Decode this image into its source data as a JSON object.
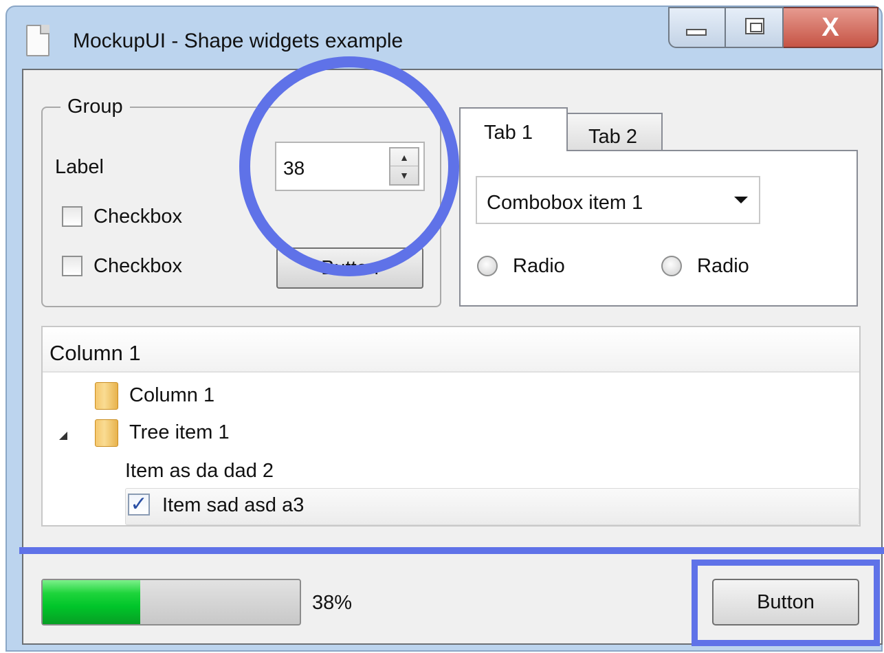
{
  "window": {
    "title": "MockupUI - Shape widgets example",
    "close_glyph": "X",
    "controls": [
      "minimize-icon",
      "maximize-icon",
      "close-icon"
    ]
  },
  "group": {
    "title": "Group",
    "label": "Label",
    "checkboxes": [
      {
        "label": "Checkbox",
        "checked": false
      },
      {
        "label": "Checkbox",
        "checked": false
      }
    ],
    "spinbox_value": "38",
    "button_label": "Button"
  },
  "tabs": {
    "items": [
      {
        "label": "Tab 1",
        "active": true
      },
      {
        "label": "Tab 2",
        "active": false
      }
    ],
    "combobox_value": "Combobox item 1",
    "radios": [
      {
        "label": "Radio",
        "selected": false
      },
      {
        "label": "Radio",
        "selected": false
      }
    ]
  },
  "tree": {
    "header": "Column 1",
    "items": [
      {
        "label": "Column 1",
        "icon": "folder-icon"
      },
      {
        "label": "Tree item 1",
        "icon": "folder-icon",
        "expanded": true
      },
      {
        "label": "Item as da dad 2"
      },
      {
        "label": "Item sad asd a3",
        "checked": true,
        "check_glyph": "✓"
      }
    ]
  },
  "footer": {
    "progress": 0.38,
    "progress_text": "38%",
    "button_label": "Button"
  },
  "annotations": {
    "highlight_color": "#5f72e8"
  }
}
